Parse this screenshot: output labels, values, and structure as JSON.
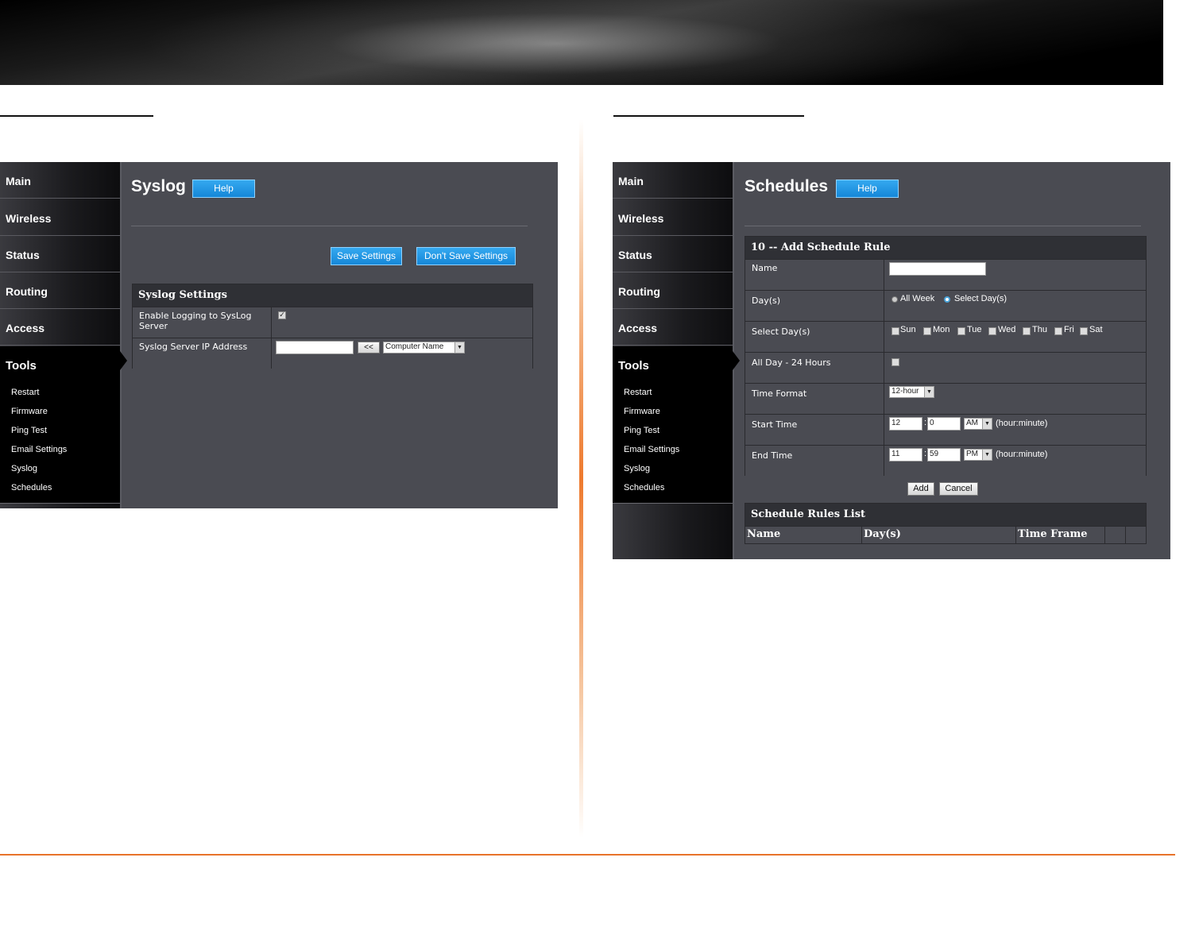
{
  "colors": {
    "accent_orange": "#e8732a",
    "button_blue": "#1f97e6",
    "panel_bg": "#4a4b52"
  },
  "nav": {
    "main": "Main",
    "wireless": "Wireless",
    "status": "Status",
    "routing": "Routing",
    "access": "Access",
    "tools": "Tools",
    "tools_items": [
      "Restart",
      "Firmware",
      "Ping Test",
      "Email Settings",
      "Syslog",
      "Schedules"
    ]
  },
  "syslog": {
    "title": "Syslog",
    "help": "Help",
    "save": "Save Settings",
    "dont_save": "Don't Save Settings",
    "section_title": "Syslog Settings",
    "enable_label": "Enable Logging to SysLog Server",
    "enable_checked": true,
    "server_ip_label": "Syslog Server IP Address",
    "server_ip_value": "",
    "copy_button": "<<",
    "computer_select": "Computer Name"
  },
  "schedules": {
    "title": "Schedules",
    "help": "Help",
    "rule_title": "10 -- Add Schedule Rule",
    "name_label": "Name",
    "name_value": "",
    "days_label": "Day(s)",
    "all_week": "All Week",
    "select_days": "Select Day(s)",
    "select_days_label": "Select Day(s)",
    "days": [
      "Sun",
      "Mon",
      "Tue",
      "Wed",
      "Thu",
      "Fri",
      "Sat"
    ],
    "all_day_label": "All Day - 24 Hours",
    "time_format_label": "Time Format",
    "time_format_value": "12-hour",
    "start_label": "Start Time",
    "start_hour": "12",
    "start_minute": "0",
    "start_ampm": "AM",
    "end_label": "End Time",
    "end_hour": "11",
    "end_minute": "59",
    "end_ampm": "PM",
    "time_hint": "(hour:minute)",
    "colon": ":",
    "add": "Add",
    "cancel": "Cancel",
    "list_title": "Schedule Rules List",
    "columns": [
      "Name",
      "Day(s)",
      "Time Frame"
    ]
  }
}
